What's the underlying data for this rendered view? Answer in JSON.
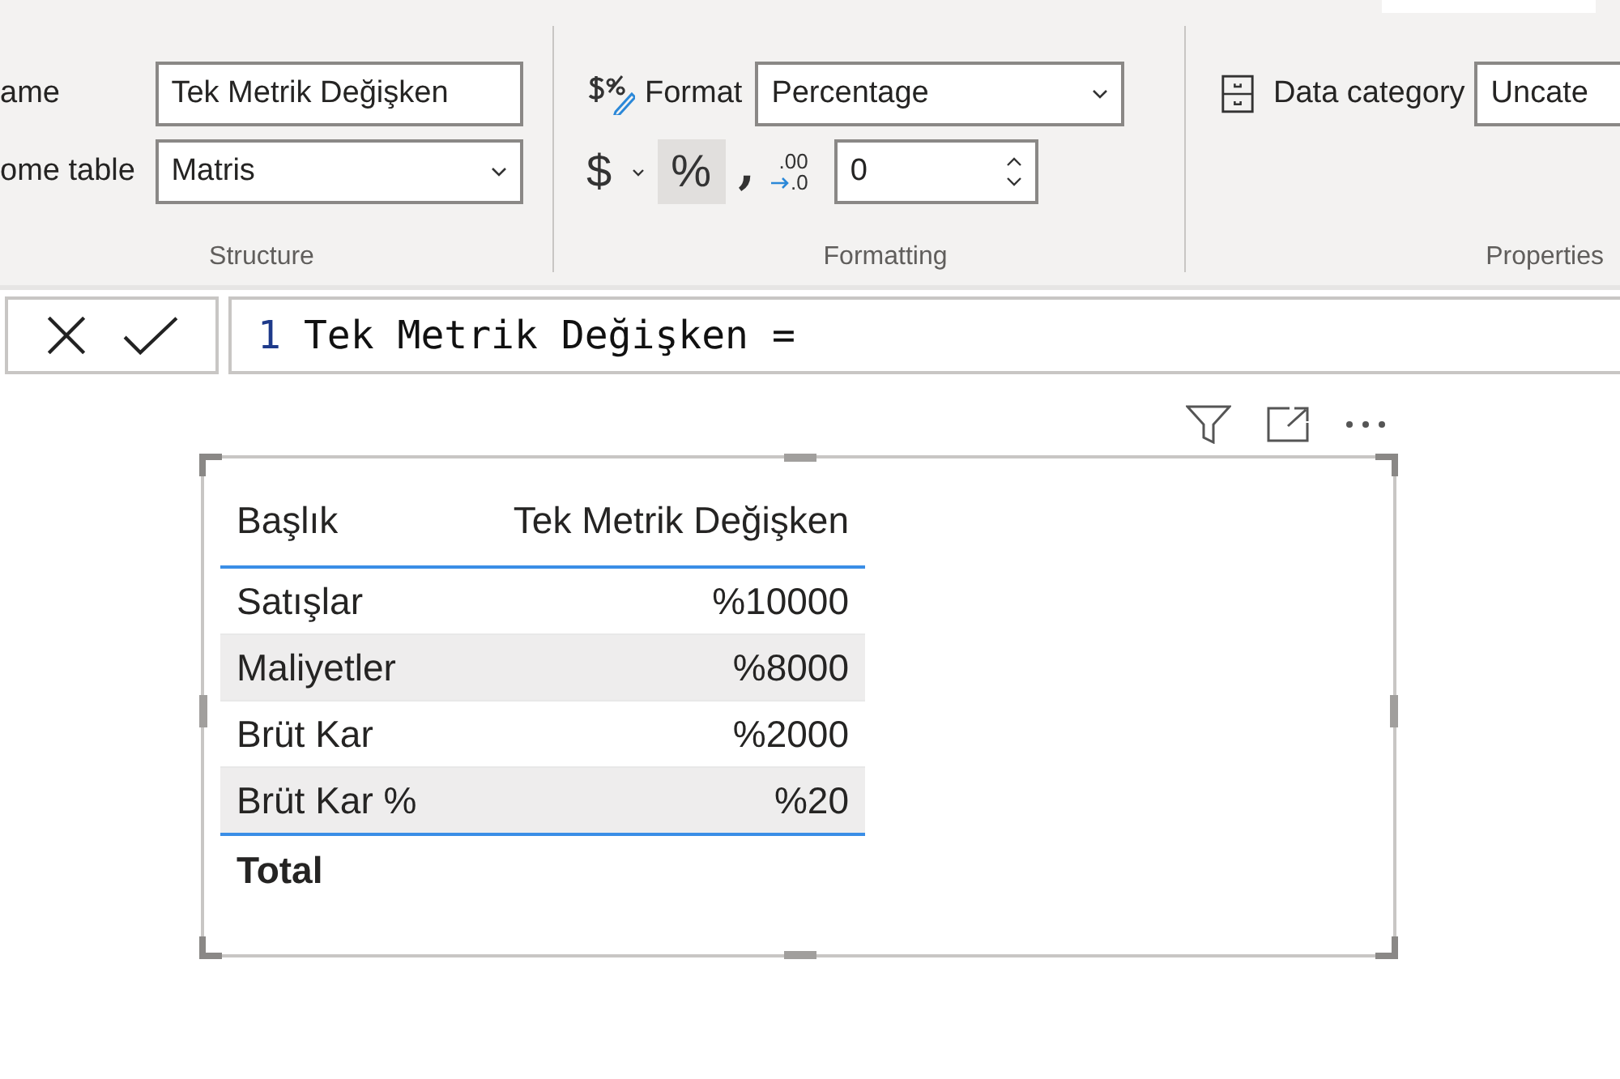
{
  "ribbon": {
    "groups": [
      {
        "kind": "structure",
        "title": "Structure",
        "name_label": "ame",
        "name_value": "Tek Metrik Değişken",
        "table_label": "ome table",
        "table_value": "Matris"
      },
      {
        "kind": "formatting",
        "title": "Formatting",
        "format_label": "Format",
        "format_value": "Percentage",
        "buttons": [
          {
            "kind": "currency",
            "text": "$",
            "selected": false
          },
          {
            "kind": "percent",
            "text": "%",
            "selected": true
          },
          {
            "kind": "comma",
            "text": ",",
            "selected": false
          },
          {
            "kind": "decimal",
            "text": ".00",
            "text2": ".0",
            "selected": false
          }
        ],
        "decimals_value": "0"
      },
      {
        "kind": "properties",
        "title": "Properties",
        "category_label": "Data category",
        "category_value": "Uncate"
      }
    ]
  },
  "formula_bar": {
    "line_number": "1",
    "formula": "Tek Metrik Değişken ="
  },
  "matrix": {
    "columns": [
      "Başlık",
      "Tek Metrik Değişken"
    ],
    "rows": [
      {
        "label": "Satışlar",
        "value": "%10000"
      },
      {
        "label": "Maliyetler",
        "value": "%8000"
      },
      {
        "label": "Brüt Kar",
        "value": "%2000"
      },
      {
        "label": "Brüt Kar %",
        "value": "%20"
      }
    ],
    "total_label": "Total"
  }
}
